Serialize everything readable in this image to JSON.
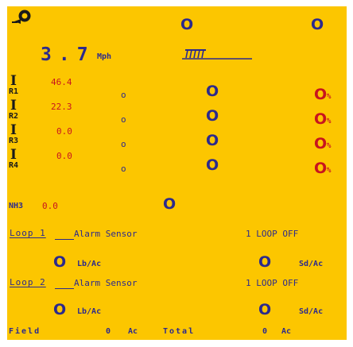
{
  "header": {
    "left_value": "O",
    "right_value": "O",
    "icon": "tractor-hitch-icon"
  },
  "speed": {
    "value": "3.7",
    "unit": "Mph",
    "implement_icon": "implement-icon"
  },
  "rows": [
    {
      "i_label": "I",
      "r_label": "R1",
      "rate": "46.4",
      "small": "o",
      "big": "O",
      "pct": "O",
      "pct_unit": "%"
    },
    {
      "i_label": "I",
      "r_label": "R2",
      "rate": "22.3",
      "small": "o",
      "big": "O",
      "pct": "O",
      "pct_unit": "%"
    },
    {
      "i_label": "I",
      "r_label": "R3",
      "rate": "0.0",
      "small": "o",
      "big": "O",
      "pct": "O",
      "pct_unit": "%"
    },
    {
      "i_label": "I",
      "r_label": "R4",
      "rate": "0.0",
      "small": "o",
      "big": "O",
      "pct": "O",
      "pct_unit": "%"
    }
  ],
  "nh3": {
    "label": "NH3",
    "value": "0.0",
    "status": "O"
  },
  "loop1": {
    "name": "Loop 1",
    "alarm": "Alarm Sensor",
    "loop_state": "1 LOOP OFF",
    "rate_value": "O",
    "rate_unit": "Lb/Ac",
    "seed_value": "O",
    "seed_unit": "Sd/Ac"
  },
  "loop2": {
    "name": "Loop 2",
    "alarm": "Alarm Sensor",
    "loop_state": "1 LOOP OFF",
    "rate_value": "O",
    "rate_unit": "Lb/Ac",
    "seed_value": "O",
    "seed_unit": "Sd/Ac"
  },
  "footer": {
    "field_label": "Field",
    "field_value": "0",
    "field_unit": "Ac",
    "total_label": "Total",
    "total_value": "0",
    "total_unit": "Ac"
  },
  "colors": {
    "background": "#fcc600",
    "navy": "#2c2a8c",
    "red": "#c8141e",
    "dark": "#1a1a1a"
  }
}
